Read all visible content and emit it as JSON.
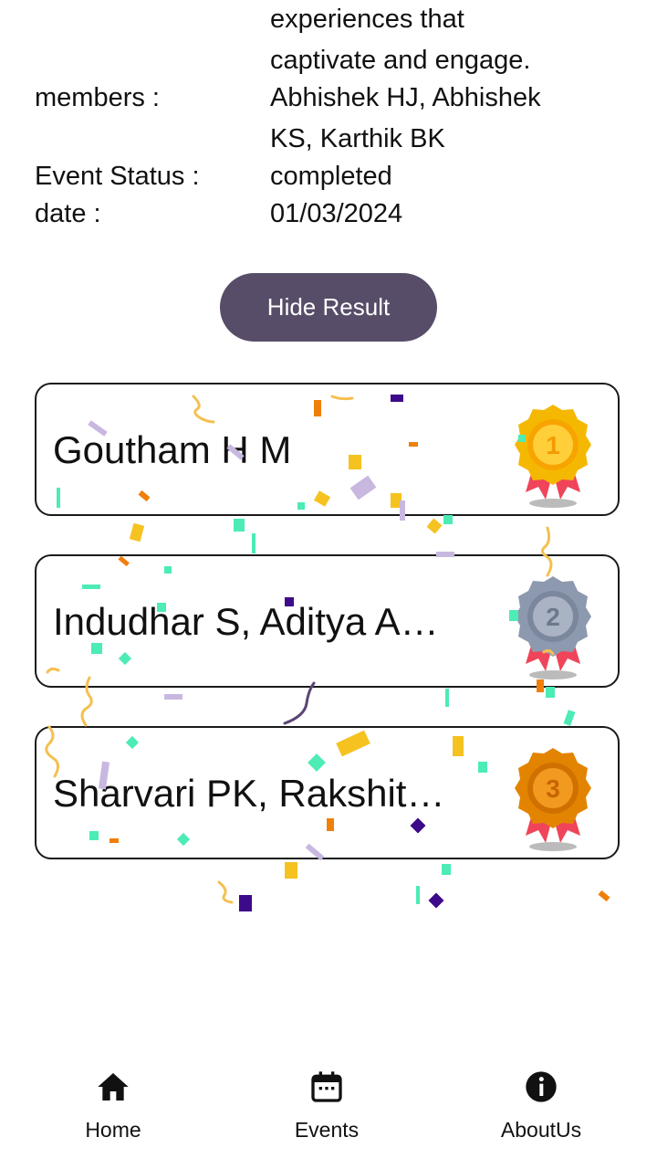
{
  "event_details": {
    "description_tail_1": "experiences that",
    "description_tail_2": "captivate and engage.",
    "members_label": "members :",
    "members_value_1": "Abhishek HJ, Abhishek",
    "members_value_2": "KS, Karthik BK",
    "status_label": "Event Status :",
    "status_value": "completed",
    "date_label": "date :",
    "date_value": "01/03/2024"
  },
  "hide_result_button": "Hide Result",
  "results": [
    {
      "name": "Goutham H M",
      "rank": "1",
      "medal": "gold-medal-icon"
    },
    {
      "name": "Indudhar S, Aditya A…",
      "rank": "2",
      "medal": "silver-medal-icon"
    },
    {
      "name": "Sharvari PK, Rakshit…",
      "rank": "3",
      "medal": "bronze-medal-icon"
    }
  ],
  "bottom_nav": {
    "home": "Home",
    "events": "Events",
    "about": "AboutUs"
  },
  "colors": {
    "button_bg": "#574d68",
    "gold": "#f5b800",
    "silver": "#8d99ae",
    "bronze": "#e38400",
    "ribbon": "#f0445a"
  }
}
